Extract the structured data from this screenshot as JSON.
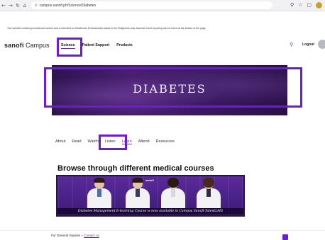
{
  "browser": {
    "back_icon": "back-arrow-icon",
    "url": "campus.sanofi.ph/Science/Diabetes"
  },
  "disclaimer": "This website contains promotional content and is intended for Healthcare Professionals based in the Philippines only. Adverse event reporting can be found at the bottom of the page",
  "header": {
    "logo": "sanofi",
    "campus": "Campus",
    "nav": [
      "Science",
      "Patient Support",
      "Products"
    ],
    "logout": "Logout"
  },
  "hero": {
    "title": "DIABETES"
  },
  "tabs": [
    "About",
    "Read",
    "Watch",
    "Listen",
    "Learn",
    "Attend",
    "Resources"
  ],
  "section": {
    "title": "Browse through different medical courses"
  },
  "banner": {
    "logo": "sanofi",
    "caption": "Diabetes Management E-learning Course is now available in Campus Sanofi-TalentLMS"
  },
  "footer": {
    "label": "For General Inquires – ",
    "link": "Contact us"
  },
  "colors": {
    "accent": "#6b2fbd",
    "highlight": "#6c1cd6",
    "hero_bg": "#3b1a63"
  }
}
